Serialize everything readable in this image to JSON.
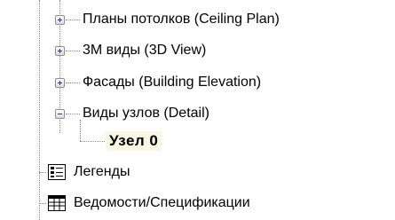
{
  "tree": {
    "children": [
      {
        "label": "Планы потолков (Ceiling Plan)",
        "state": "collapsed"
      },
      {
        "label": "3М виды (3D View)",
        "state": "collapsed"
      },
      {
        "label": "Фасады (Building Elevation)",
        "state": "collapsed"
      },
      {
        "label": "Виды узлов (Detail)",
        "state": "expanded"
      }
    ],
    "selected_leaf": {
      "label": "Узел 0"
    },
    "root_items": [
      {
        "label": "Легенды",
        "icon": "legend-icon"
      },
      {
        "label": "Ведомости/Спецификации",
        "icon": "schedule-icon"
      }
    ]
  }
}
